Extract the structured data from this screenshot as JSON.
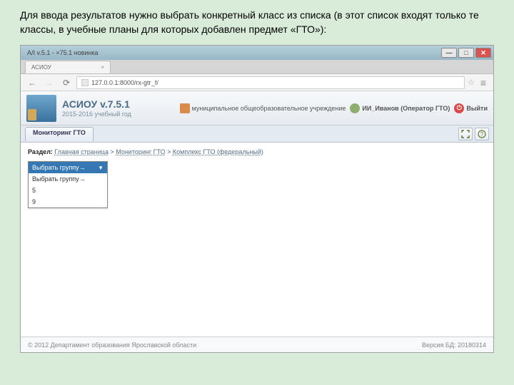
{
  "caption": "Для ввода результатов нужно выбрать конкретный класс из списка (в этот список входят только те классы, в учебные планы для которых добавлен предмет «ГТО»):",
  "window": {
    "title": "A/I v.5.1 - ×75.1 новинка"
  },
  "tab": {
    "label": "АСИОУ"
  },
  "addr": {
    "url": "127.0.0.1:8000/rх-gtг_f/"
  },
  "app": {
    "title": "АСИОУ v.7.5.1",
    "subtitle": "2015-2016 учебный год",
    "org": "муниципальное общеобразовательное учреждение",
    "user_label": "ИИ_Иванов (Оператор ГТО)",
    "logout": "Выйти"
  },
  "page_tab": "Мониторинг ГТО",
  "breadcrumb": {
    "label": "Раздел:",
    "home": "Главная страница",
    "mon": "Мониторинг ГТО",
    "gto": "Комплекс ГТО (федеральный)"
  },
  "dropdown": {
    "head": "Выбрать группу→",
    "items": [
      "Выбрать группу→",
      "5",
      "9"
    ]
  },
  "footer": {
    "copy": "© 2012 Департамент образования Ярославской области",
    "version": "Версия БД: 20180314"
  }
}
